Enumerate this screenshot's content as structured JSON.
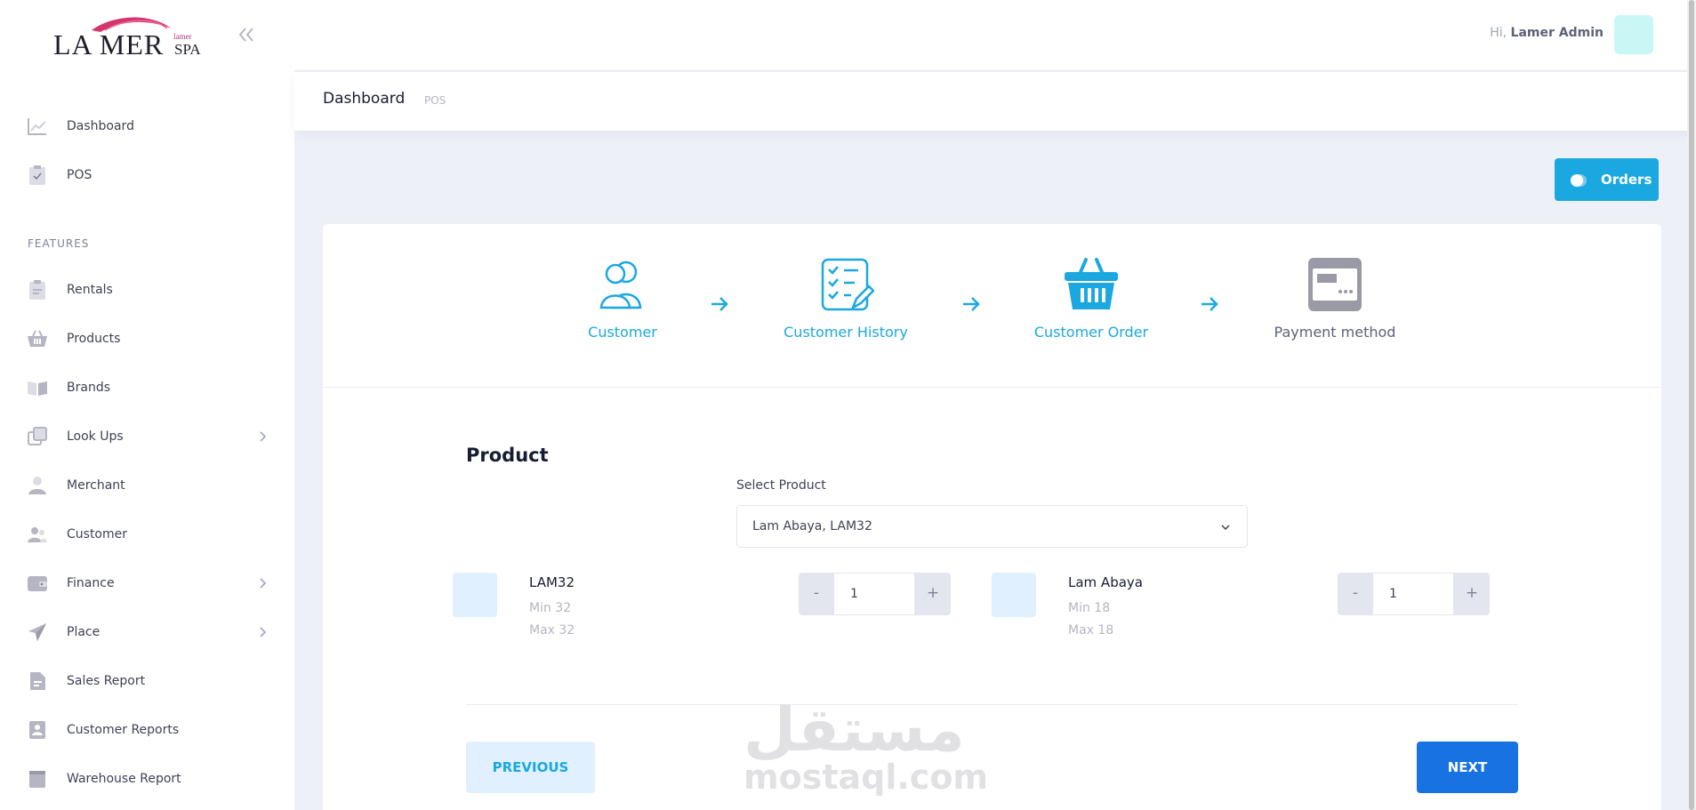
{
  "brand": {
    "logo_main": "LA MER",
    "logo_suffix": "SPA",
    "logo_small": "lamer"
  },
  "sidebar": {
    "items_top": [
      {
        "label": "Dashboard",
        "icon": "chart-line-icon"
      },
      {
        "label": "POS",
        "icon": "clipboard-check-icon"
      }
    ],
    "section_title": "FEATURES",
    "items": [
      {
        "label": "Rentals",
        "icon": "clipboard-icon"
      },
      {
        "label": "Products",
        "icon": "basket-icon"
      },
      {
        "label": "Brands",
        "icon": "book-icon"
      },
      {
        "label": "Look Ups",
        "icon": "layers-icon"
      },
      {
        "label": "Merchant",
        "icon": "user-icon"
      },
      {
        "label": "Customer",
        "icon": "users-icon"
      },
      {
        "label": "Finance",
        "icon": "wallet-icon"
      },
      {
        "label": "Place",
        "icon": "navigation-icon"
      },
      {
        "label": "Sales Report",
        "icon": "file-icon"
      },
      {
        "label": "Customer Reports",
        "icon": "contact-card-icon"
      },
      {
        "label": "Warehouse Report",
        "icon": "box-icon"
      }
    ]
  },
  "header": {
    "greeting_prefix": "Hi,",
    "user_name": "Lamer Admin"
  },
  "subheader": {
    "title": "Dashboard",
    "crumb": "POS"
  },
  "orders_button": "Orders",
  "wizard": {
    "steps": [
      {
        "label": "Customer",
        "icon": "users-outline-icon",
        "state": "done"
      },
      {
        "label": "Customer History",
        "icon": "checklist-edit-icon",
        "state": "done"
      },
      {
        "label": "Customer Order",
        "icon": "basket-icon",
        "state": "current"
      },
      {
        "label": "Payment method",
        "icon": "payment-card-icon",
        "state": "pending"
      }
    ]
  },
  "form": {
    "title": "Product",
    "select_label": "Select Product",
    "select_value": "Lam Abaya, LAM32"
  },
  "products": [
    {
      "name": "LAM32",
      "min": "Min 32",
      "max": "Max 32",
      "qty": "1"
    },
    {
      "name": "Lam Abaya",
      "min": "Min 18",
      "max": "Max 18",
      "qty": "1"
    }
  ],
  "qty_controls": {
    "minus": "-",
    "plus": "+"
  },
  "buttons": {
    "previous": "PREVIOUS",
    "next": "NEXT"
  },
  "watermark": {
    "arabic": "مستقل",
    "latin": "mostaql.com"
  },
  "colors": {
    "accent": "#1ba8e0",
    "primary": "#1872e2",
    "icon_gray": "#b5b5c3",
    "inactive_icon": "#9a9aa6"
  }
}
